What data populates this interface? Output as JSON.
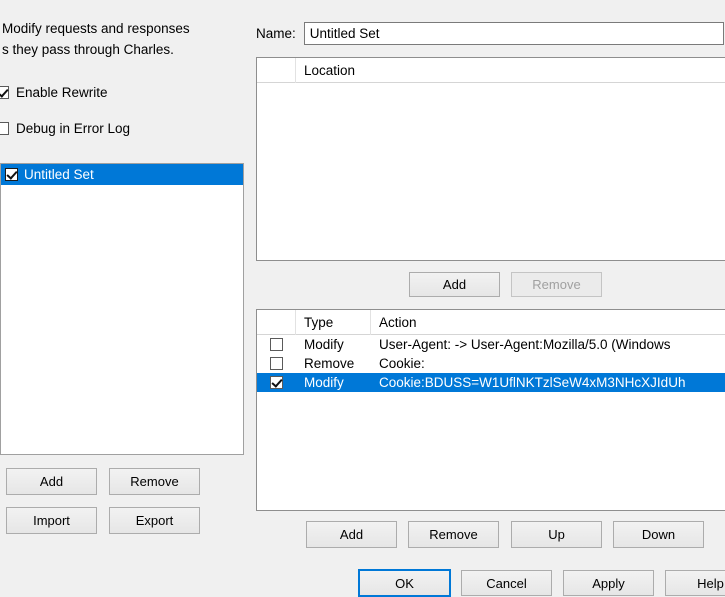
{
  "left": {
    "description": "Modify requests and responses\ns they pass through Charles.",
    "options": [
      {
        "label": "Enable Rewrite",
        "checked": true
      },
      {
        "label": "Debug in Error Log",
        "checked": false
      }
    ],
    "sets": [
      {
        "label": "Untitled Set",
        "checked": true,
        "selected": true
      }
    ],
    "buttons": {
      "add": "Add",
      "remove": "Remove",
      "import": "Import",
      "export": "Export"
    }
  },
  "right": {
    "name_label": "Name:",
    "name_value": "Untitled Set",
    "location_table": {
      "columns": [
        "",
        "Location"
      ],
      "rows": []
    },
    "location_buttons": {
      "add": "Add",
      "remove": "Remove",
      "remove_enabled": false
    },
    "rule_table": {
      "columns": [
        "",
        "Type",
        "Action"
      ],
      "rows": [
        {
          "checked": false,
          "type": "Modify",
          "action": "User-Agent: -> User-Agent:Mozilla/5.0 (Windows",
          "selected": false
        },
        {
          "checked": false,
          "type": "Remove",
          "action": "Cookie:",
          "selected": false
        },
        {
          "checked": true,
          "type": "Modify",
          "action": "Cookie:BDUSS=W1UflNKTzlSeW4xM3NHcXJIdUh",
          "selected": true
        }
      ]
    },
    "rule_buttons": {
      "add": "Add",
      "remove": "Remove",
      "up": "Up",
      "down": "Down"
    }
  },
  "dialog_buttons": {
    "ok": "OK",
    "cancel": "Cancel",
    "apply": "Apply",
    "help": "Help",
    "focused": "ok"
  },
  "colors": {
    "selection": "#0078d7",
    "window_bg": "#f0f0f0",
    "field_bg": "#ffffff",
    "border": "#8e8e8e"
  }
}
